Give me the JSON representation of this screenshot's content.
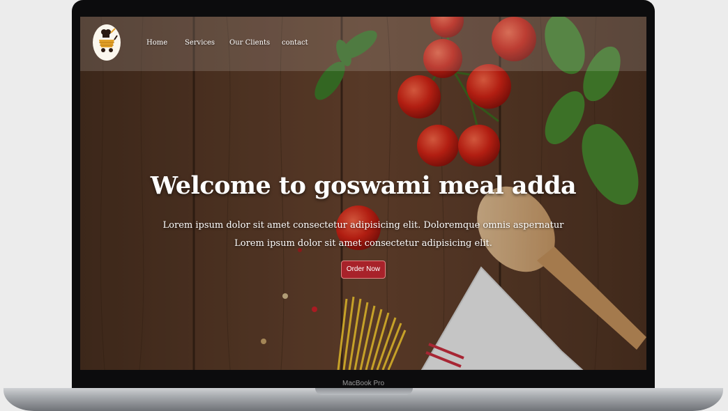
{
  "device": {
    "label": "MacBook Pro"
  },
  "brand": {
    "logo_icon": "food-cart-chef-logo"
  },
  "nav": {
    "items": [
      {
        "label": "Home"
      },
      {
        "label": "Services"
      },
      {
        "label": "Our Clients"
      },
      {
        "label": "contact"
      }
    ]
  },
  "hero": {
    "title": "Welcome to goswami meal adda",
    "line1": "Lorem ipsum dolor sit amet consectetur adipisicing elit. Doloremque omnis aspernatur",
    "line2": "Lorem ipsum dolor sit amet consectetur adipisicing elit.",
    "cta_label": "Order Now"
  },
  "colors": {
    "cta": "#a8222a",
    "wood": "#5a3b2a",
    "tomato": "#d92516",
    "basil": "#3f7d2a"
  }
}
